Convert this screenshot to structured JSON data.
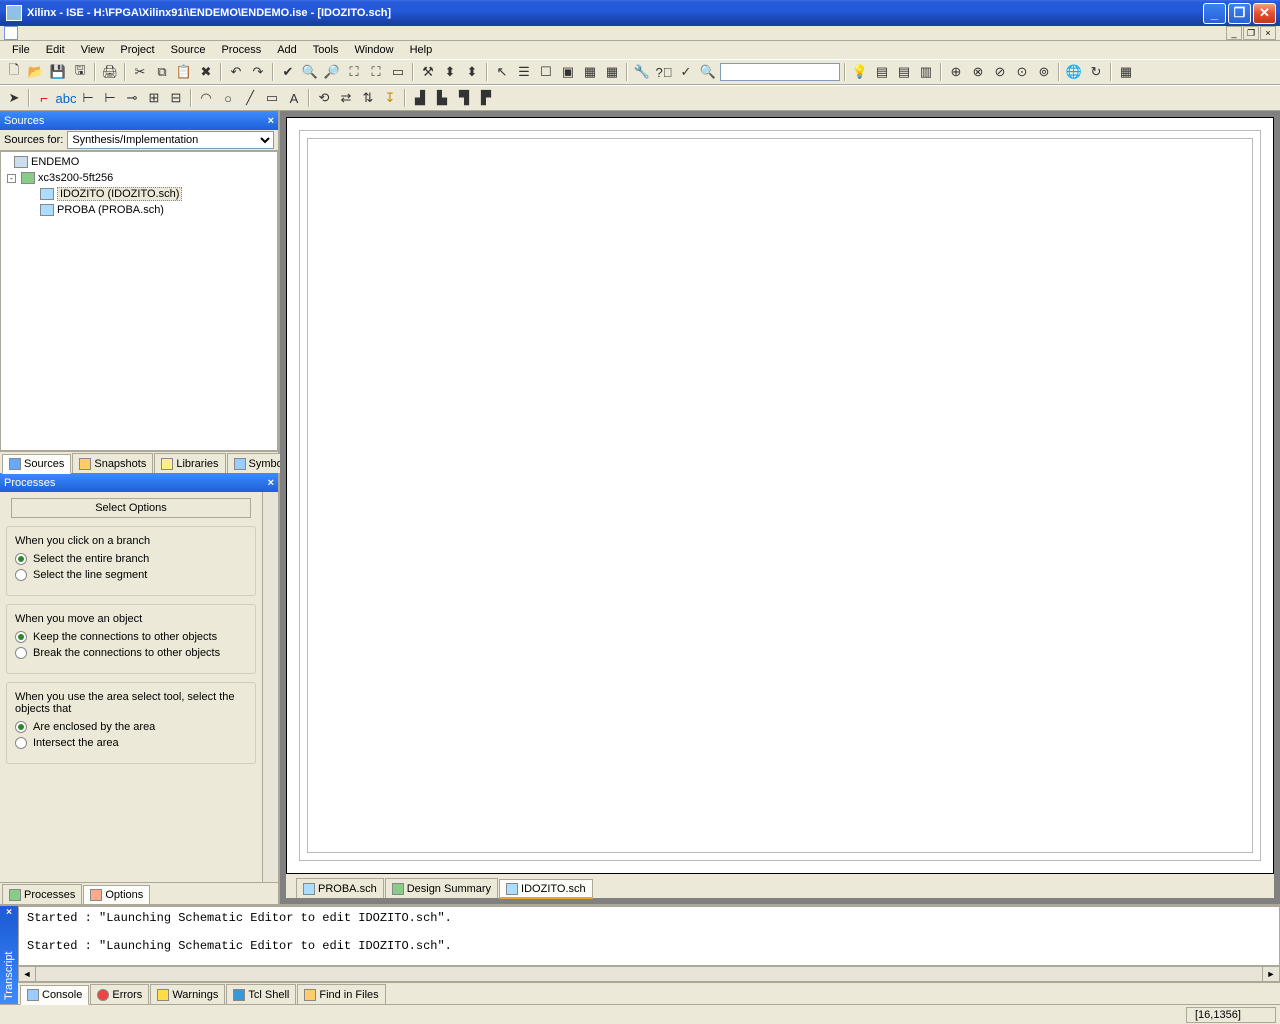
{
  "window": {
    "title": "Xilinx - ISE - H:\\FPGA\\Xilinx91i\\ENDEMO\\ENDEMO.ise - [IDOZITO.sch]"
  },
  "menu": {
    "items": [
      "File",
      "Edit",
      "View",
      "Project",
      "Source",
      "Process",
      "Add",
      "Tools",
      "Window",
      "Help"
    ]
  },
  "sources": {
    "panel_title": "Sources",
    "label": "Sources for:",
    "dropdown": "Synthesis/Implementation",
    "tree": {
      "root": "ENDEMO",
      "device": "xc3s200-5ft256",
      "files": [
        "IDOZITO (IDOZITO.sch)",
        "PROBA (PROBA.sch)"
      ]
    },
    "tabs": [
      "Sources",
      "Snapshots",
      "Libraries",
      "Symbols"
    ]
  },
  "processes": {
    "panel_title": "Processes",
    "select_button": "Select Options",
    "groups": [
      {
        "title": "When you click on a branch",
        "opts": [
          "Select the entire branch",
          "Select the line segment"
        ],
        "sel": 0
      },
      {
        "title": "When you move an object",
        "opts": [
          "Keep the connections to other objects",
          "Break the connections to other objects"
        ],
        "sel": 0
      },
      {
        "title": "When you use the area select tool, select the objects that",
        "opts": [
          "Are enclosed by the area",
          "Intersect the area"
        ],
        "sel": 0
      }
    ],
    "tabs": [
      "Processes",
      "Options"
    ]
  },
  "editor_tabs": [
    "PROBA.sch",
    "Design Summary",
    "IDOZITO.sch"
  ],
  "console": {
    "side_label": "Transcript",
    "text": "Started : \"Launching Schematic Editor to edit IDOZITO.sch\".\n\nStarted : \"Launching Schematic Editor to edit IDOZITO.sch\".\n",
    "tabs": [
      "Console",
      "Errors",
      "Warnings",
      "Tcl Shell",
      "Find in Files"
    ]
  },
  "status": {
    "coords": "[16,1356]"
  }
}
